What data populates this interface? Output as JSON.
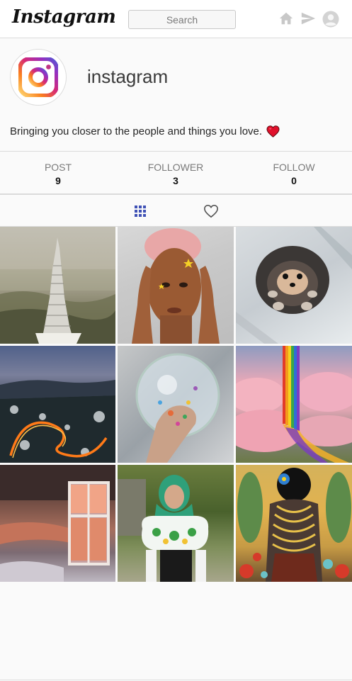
{
  "header": {
    "logo_text": "Instagram",
    "search_placeholder": "Search",
    "icons": [
      "home-icon",
      "send-icon",
      "avatar-icon"
    ]
  },
  "profile": {
    "username": "instagram",
    "bio": "Bringing you closer to the people and things you love.",
    "bio_emoji": "heart-icon"
  },
  "stats": {
    "post_label": "POST",
    "post_value": "9",
    "follower_label": "FOLLOWER",
    "follower_value": "3",
    "follow_label": "FOLLOW",
    "follow_value": "0"
  },
  "tabs": {
    "grid_icon": "grid-icon",
    "liked_icon": "heart-outline-icon"
  },
  "colors": {
    "brand_gradient": [
      "#feda75",
      "#fa7e1e",
      "#d62976",
      "#962fbf",
      "#4f5bd5"
    ],
    "grid_tab_active": "#3f51b5",
    "heart": "#e0102b"
  },
  "posts": [
    {
      "name": "post-pagoda-tower"
    },
    {
      "name": "post-woman-portrait"
    },
    {
      "name": "post-pomeranian-dog"
    },
    {
      "name": "post-road-light-trails"
    },
    {
      "name": "post-glass-bubble-hand"
    },
    {
      "name": "post-pink-clouds-rainbow"
    },
    {
      "name": "post-window-sunset"
    },
    {
      "name": "post-woman-green-hijab"
    },
    {
      "name": "post-gold-necklace-art"
    }
  ]
}
